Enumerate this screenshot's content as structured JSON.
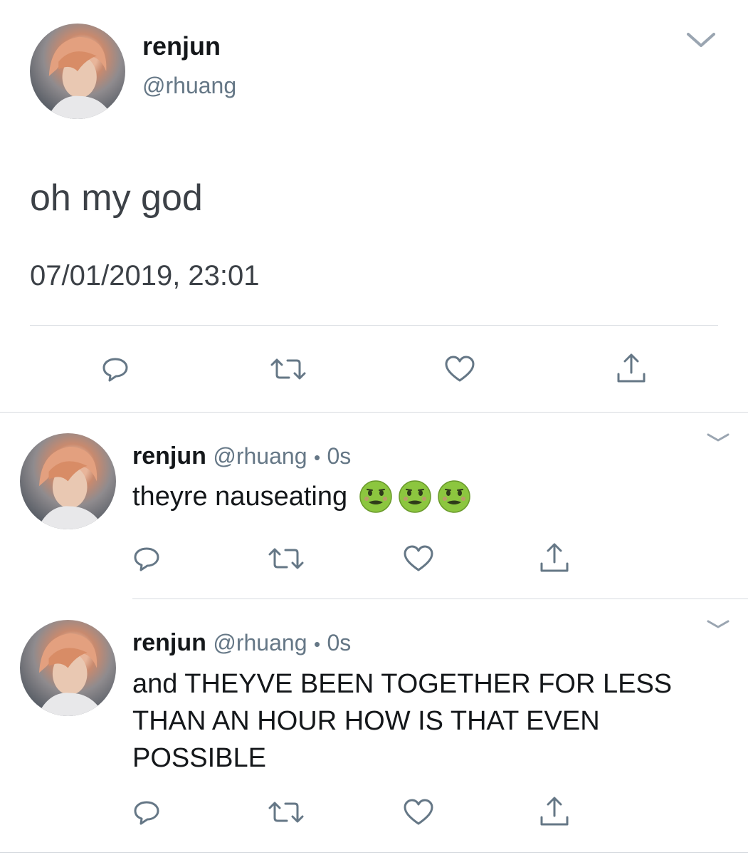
{
  "main_tweet": {
    "display_name": "renjun",
    "handle": "@rhuang",
    "text": "oh my god",
    "timestamp": "07/01/2019, 23:01"
  },
  "replies": [
    {
      "display_name": "renjun",
      "handle": "@rhuang",
      "separator": "•",
      "time": "0s",
      "text": "theyre nauseating"
    },
    {
      "display_name": "renjun",
      "handle": "@rhuang",
      "separator": "•",
      "time": "0s",
      "line1": "and THEYVE BEEN TOGETHER FOR LESS",
      "line2": "THAN AN HOUR HOW IS THAT EVEN",
      "line3": "POSSIBLE"
    }
  ],
  "icons": {
    "reply": "reply-icon",
    "retweet": "retweet-icon",
    "like": "heart-icon",
    "share": "share-icon",
    "more": "chevron-down-icon",
    "emoji": "nauseated-face-emoji"
  },
  "colors": {
    "text": "#14171a",
    "secondary": "#657786",
    "icon": "#657786",
    "divider": "#d7dbe0",
    "emoji_face": "#8cc63f"
  }
}
